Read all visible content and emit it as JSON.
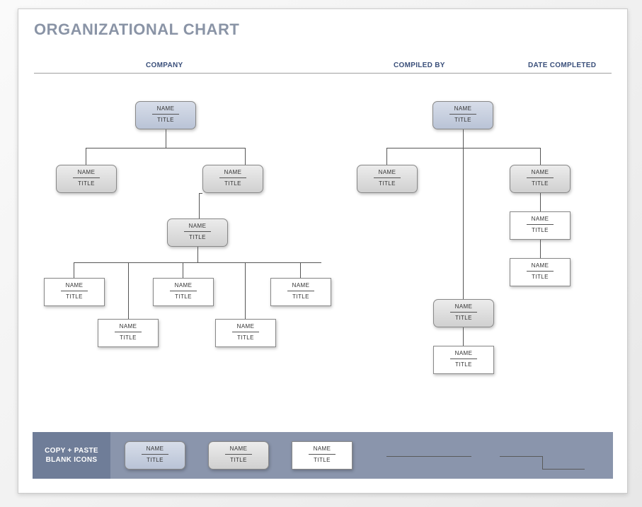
{
  "header": {
    "title": "ORGANIZATIONAL CHART",
    "company_label": "COMPANY",
    "compiled_label": "COMPILED BY",
    "date_label": "DATE COMPLETED"
  },
  "placeholder": {
    "name": "NAME",
    "title": "TITLE"
  },
  "footer": {
    "label": "COPY + PASTE BLANK ICONS"
  }
}
